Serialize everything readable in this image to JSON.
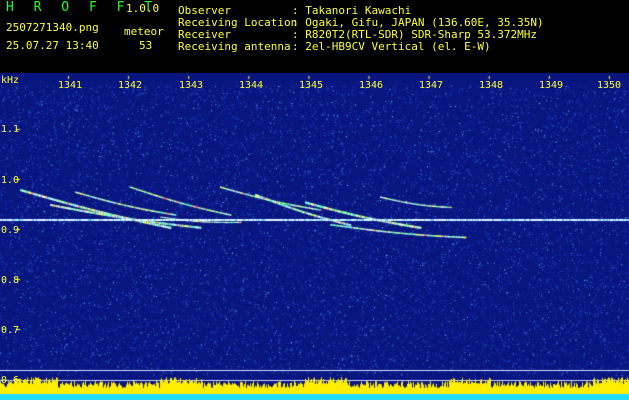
{
  "header": {
    "brand": "H R O F F T",
    "version": "1.0.0",
    "filename": "2507271340.png",
    "datetime": "25.07.27 13:40",
    "meteor_label": "meteor",
    "meteor_count": "53",
    "info": [
      {
        "label": "Observer",
        "value": ": Takanori Kawachi"
      },
      {
        "label": "Receiving Location",
        "value": ": Ogaki, Gifu, JAPAN (136.60E, 35.35N)"
      },
      {
        "label": "Receiver",
        "value": ": R820T2(RTL-SDR) SDR-Sharp 53.372MHz"
      },
      {
        "label": "Receiving antenna",
        "value": ": 2el-HB9CV Vertical (el. E-W)"
      }
    ]
  },
  "spectrogram": {
    "y_unit": "kHz",
    "y_ticks": [
      "1.1",
      "1.0",
      "0.9",
      "0.8",
      "0.7",
      "0.6"
    ],
    "x_ticks": [
      "1341",
      "1342",
      "1343",
      "1344",
      "1345",
      "1346",
      "1347",
      "1348",
      "1349",
      "1350"
    ],
    "carrier_khz": 0.92,
    "colors": {
      "background": "#0a1680",
      "carrier": "#e0f4ff",
      "signal_bar": "#ffee00",
      "base_bar": "#22ddff",
      "axis": "#ffff33"
    }
  }
}
